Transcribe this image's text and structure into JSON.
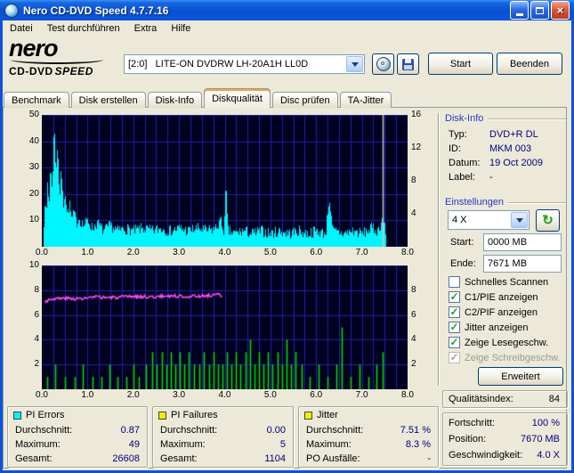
{
  "window": {
    "title": "Nero CD-DVD Speed 4.7.7.16"
  },
  "menu": {
    "items": [
      "Datei",
      "Test durchführen",
      "Extra",
      "Hilfe"
    ]
  },
  "logo": {
    "brand": "nero",
    "product1": "CD-DVD",
    "product2": "SPEED"
  },
  "toolbar": {
    "drive": "[2:0]   LITE-ON DVDRW LH-20A1H LL0D",
    "start": "Start",
    "quit": "Beenden"
  },
  "tabs": {
    "items": [
      "Benchmark",
      "Disk erstellen",
      "Disk-Info",
      "Diskqualität",
      "Disc prüfen",
      "TA-Jitter"
    ],
    "active": "Diskqualität"
  },
  "disk_info": {
    "title": "Disk-Info",
    "rows": [
      {
        "label": "Typ:",
        "value": "DVD+R DL"
      },
      {
        "label": "ID:",
        "value": "MKM 003"
      },
      {
        "label": "Datum:",
        "value": "19 Oct 2009"
      },
      {
        "label": "Label:",
        "value": "-"
      }
    ]
  },
  "settings": {
    "title": "Einstellungen",
    "speed_value": "4 X",
    "start_label": "Start:",
    "start_value": "0000 MB",
    "end_label": "Ende:",
    "end_value": "7671 MB",
    "advanced_label": "Erweitert",
    "checkboxes": [
      {
        "label": "Schnelles Scannen",
        "checked": false,
        "enabled": true
      },
      {
        "label": "C1/PIE anzeigen",
        "checked": true,
        "enabled": true
      },
      {
        "label": "C2/PIF anzeigen",
        "checked": true,
        "enabled": true
      },
      {
        "label": "Jitter anzeigen",
        "checked": true,
        "enabled": true
      },
      {
        "label": "Zeige Lesegeschw.",
        "checked": true,
        "enabled": true
      },
      {
        "label": "Zeige Schreibgeschw.",
        "checked": true,
        "enabled": false
      }
    ]
  },
  "quality": {
    "label": "Qualitätsindex:",
    "value": "84"
  },
  "progress": {
    "rows": [
      {
        "label": "Fortschritt:",
        "value": "100 %"
      },
      {
        "label": "Position:",
        "value": "7670 MB"
      },
      {
        "label": "Geschwindigkeit:",
        "value": "4.0 X"
      }
    ]
  },
  "stats": [
    {
      "title": "PI Errors",
      "color": "#00F5FF",
      "rows": [
        [
          "Durchschnitt:",
          "0.87"
        ],
        [
          "Maximum:",
          "49"
        ],
        [
          "Gesamt:",
          "26608"
        ]
      ]
    },
    {
      "title": "PI Failures",
      "color": "#F0F000",
      "rows": [
        [
          "Durchschnitt:",
          "0.00"
        ],
        [
          "Maximum:",
          "5"
        ],
        [
          "Gesamt:",
          "1104"
        ]
      ]
    },
    {
      "title": "Jitter",
      "color": "#F0F000",
      "rows": [
        [
          "Durchschnitt:",
          "7.51 %"
        ],
        [
          "Maximum:",
          "8.3 %"
        ],
        [
          "PO Ausfälle:",
          "-"
        ]
      ]
    }
  ],
  "colors": {
    "pie_trace": "#00F5FF",
    "pif_bars": "#00DC00",
    "jitter_line": "#FF50FF",
    "chart_bg": "#000020",
    "chart_grid": "#2222A8",
    "value_text": "#000080",
    "section_header": "#2438C8"
  },
  "chart_data": [
    {
      "id": "pie",
      "type": "area",
      "title": "C1/PIE errors vs. disc position (GB)",
      "x_range": [
        0,
        8
      ],
      "x_grid_step": 0.25,
      "x_tick_step": 1,
      "x_tick_labels": [
        "0.0",
        "1.0",
        "2.0",
        "3.0",
        "4.0",
        "5.0",
        "6.0",
        "7.0",
        "8.0"
      ],
      "left_axis": {
        "range": [
          0,
          50
        ],
        "ticks": [
          10,
          20,
          30,
          40,
          50
        ]
      },
      "right_axis": {
        "range": [
          0,
          16
        ],
        "ticks": [
          4,
          8,
          12,
          16
        ]
      },
      "bg": "#000020",
      "grid": "#2222A8",
      "series": [
        {
          "name": "pie-errors",
          "style": "noise-area",
          "color": "#00F5FF",
          "noise": 2.2,
          "seed": 7,
          "points": [
            [
              0.03,
              6
            ],
            [
              0.06,
              18
            ],
            [
              0.09,
              10
            ],
            [
              0.12,
              26
            ],
            [
              0.15,
              14
            ],
            [
              0.18,
              32
            ],
            [
              0.22,
              20
            ],
            [
              0.26,
              48
            ],
            [
              0.3,
              28
            ],
            [
              0.34,
              40
            ],
            [
              0.38,
              18
            ],
            [
              0.42,
              30
            ],
            [
              0.46,
              15
            ],
            [
              0.5,
              22
            ],
            [
              0.55,
              12
            ],
            [
              0.6,
              16
            ],
            [
              0.65,
              10
            ],
            [
              0.7,
              13
            ],
            [
              0.75,
              9
            ],
            [
              0.8,
              11
            ],
            [
              0.9,
              8
            ],
            [
              1.0,
              10
            ],
            [
              1.1,
              7
            ],
            [
              1.2,
              9
            ],
            [
              1.35,
              6
            ],
            [
              1.5,
              8
            ],
            [
              1.65,
              6
            ],
            [
              1.8,
              7
            ],
            [
              2.0,
              6
            ],
            [
              2.2,
              7
            ],
            [
              2.4,
              6
            ],
            [
              2.6,
              7
            ],
            [
              2.8,
              6
            ],
            [
              3.0,
              7
            ],
            [
              3.2,
              6
            ],
            [
              3.4,
              7
            ],
            [
              3.6,
              6
            ],
            [
              3.8,
              7
            ],
            [
              3.9,
              10
            ],
            [
              3.98,
              6
            ],
            [
              4.02,
              24
            ],
            [
              4.06,
              6
            ],
            [
              4.2,
              5
            ],
            [
              4.4,
              6
            ],
            [
              4.6,
              5
            ],
            [
              4.8,
              6
            ],
            [
              5.0,
              5
            ],
            [
              5.2,
              6
            ],
            [
              5.4,
              5
            ],
            [
              5.6,
              6
            ],
            [
              5.8,
              5
            ],
            [
              6.0,
              6
            ],
            [
              6.2,
              5
            ],
            [
              6.28,
              19
            ],
            [
              6.35,
              6
            ],
            [
              6.6,
              5
            ],
            [
              6.8,
              6
            ],
            [
              7.0,
              5
            ],
            [
              7.2,
              7
            ],
            [
              7.35,
              6
            ],
            [
              7.45,
              11
            ],
            [
              7.52,
              5
            ]
          ]
        },
        {
          "name": "scan-end-marker",
          "style": "vline",
          "color": "#C8C8C8",
          "x": 7.45
        }
      ]
    },
    {
      "id": "pif",
      "type": "mixed",
      "title": "C2/PIF failures (bars) and Jitter (line) vs. disc position (GB)",
      "x_range": [
        0,
        8
      ],
      "x_grid_step": 0.25,
      "x_tick_step": 1,
      "x_tick_labels": [
        "0.0",
        "1.0",
        "2.0",
        "3.0",
        "4.0",
        "5.0",
        "6.0",
        "7.0",
        "8.0"
      ],
      "left_axis": {
        "range": [
          0,
          10
        ],
        "ticks": [
          2,
          4,
          6,
          8,
          10
        ]
      },
      "right_axis": {
        "range": [
          0,
          10
        ],
        "ticks": [
          2,
          4,
          6,
          8
        ]
      },
      "bg": "#000020",
      "grid": "#2222A8",
      "series": [
        {
          "name": "pif-failures",
          "style": "bars",
          "color": "#00DC00",
          "points": [
            [
              0.12,
              1
            ],
            [
              0.3,
              2
            ],
            [
              0.5,
              1
            ],
            [
              0.72,
              1
            ],
            [
              0.9,
              2
            ],
            [
              1.1,
              1
            ],
            [
              1.3,
              1
            ],
            [
              1.48,
              2
            ],
            [
              1.65,
              1
            ],
            [
              1.85,
              1
            ],
            [
              2.0,
              2
            ],
            [
              2.12,
              1
            ],
            [
              2.28,
              2
            ],
            [
              2.42,
              3
            ],
            [
              2.52,
              2
            ],
            [
              2.62,
              3
            ],
            [
              2.72,
              2
            ],
            [
              2.82,
              3
            ],
            [
              2.92,
              2
            ],
            [
              3.02,
              3
            ],
            [
              3.12,
              2
            ],
            [
              3.22,
              3
            ],
            [
              3.32,
              2
            ],
            [
              3.45,
              2
            ],
            [
              3.55,
              3
            ],
            [
              3.65,
              2
            ],
            [
              3.75,
              3
            ],
            [
              3.85,
              2
            ],
            [
              3.95,
              2
            ],
            [
              4.05,
              3
            ],
            [
              4.15,
              2
            ],
            [
              4.25,
              3
            ],
            [
              4.35,
              2
            ],
            [
              4.45,
              3
            ],
            [
              4.55,
              4
            ],
            [
              4.65,
              2
            ],
            [
              4.75,
              3
            ],
            [
              4.85,
              2
            ],
            [
              4.95,
              3
            ],
            [
              5.05,
              2
            ],
            [
              5.15,
              3
            ],
            [
              5.25,
              2
            ],
            [
              5.35,
              4
            ],
            [
              5.45,
              2
            ],
            [
              5.55,
              3
            ],
            [
              5.68,
              2
            ],
            [
              5.85,
              1
            ],
            [
              6.05,
              2
            ],
            [
              6.25,
              1
            ],
            [
              6.45,
              2
            ],
            [
              6.55,
              5
            ],
            [
              6.75,
              1
            ],
            [
              6.95,
              2
            ],
            [
              7.15,
              1
            ],
            [
              7.32,
              2
            ],
            [
              7.45,
              3
            ]
          ]
        },
        {
          "name": "jitter",
          "style": "noise-line",
          "color": "#FF50FF",
          "noise": 0.13,
          "seed": 3,
          "points": [
            [
              0.05,
              7.1
            ],
            [
              0.2,
              7.3
            ],
            [
              0.5,
              7.35
            ],
            [
              0.8,
              7.3
            ],
            [
              1.2,
              7.45
            ],
            [
              1.6,
              7.4
            ],
            [
              2.0,
              7.5
            ],
            [
              2.4,
              7.45
            ],
            [
              2.8,
              7.55
            ],
            [
              3.2,
              7.5
            ],
            [
              3.6,
              7.55
            ],
            [
              3.85,
              7.65
            ],
            [
              3.95,
              7.45
            ]
          ]
        }
      ]
    }
  ]
}
